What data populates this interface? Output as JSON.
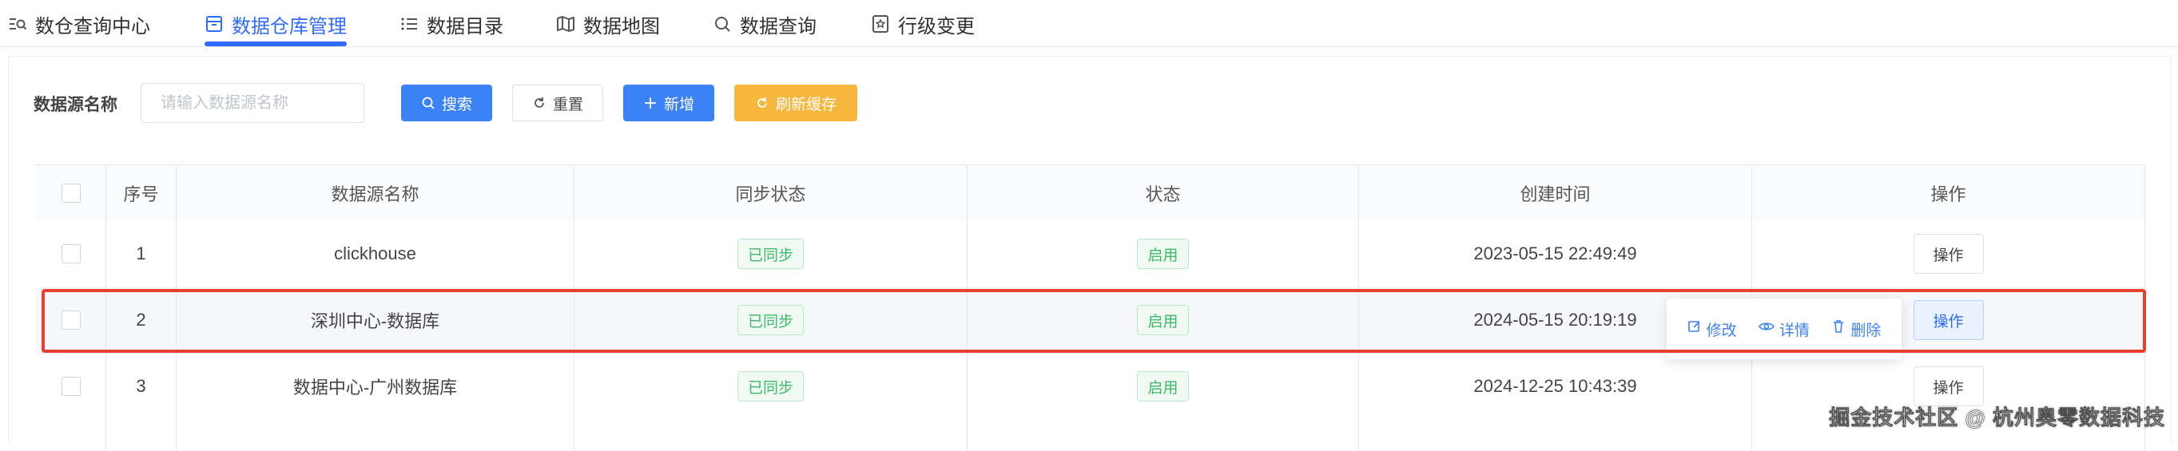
{
  "tabs": [
    {
      "label": "数仓查询中心",
      "icon": "query-list-icon"
    },
    {
      "label": "数据仓库管理",
      "icon": "warehouse-box-icon",
      "active": true
    },
    {
      "label": "数据目录",
      "icon": "catalog-list-icon"
    },
    {
      "label": "数据地图",
      "icon": "map-icon"
    },
    {
      "label": "数据查询",
      "icon": "search-icon"
    },
    {
      "label": "行级变更",
      "icon": "star-badge-icon"
    }
  ],
  "filter": {
    "label": "数据源名称",
    "placeholder": "请输入数据源名称",
    "search_label": "搜索",
    "reset_label": "重置",
    "add_label": "新增",
    "refresh_label": "刷新缓存"
  },
  "table": {
    "columns": [
      "序号",
      "数据源名称",
      "同步状态",
      "状态",
      "创建时间",
      "操作"
    ],
    "rows": [
      {
        "index": "1",
        "name": "clickhouse",
        "sync": "已同步",
        "status": "启用",
        "created": "2023-05-15 22:49:49",
        "action": "操作"
      },
      {
        "index": "2",
        "name": "深圳中心-数据库",
        "sync": "已同步",
        "status": "启用",
        "created": "2024-05-15 20:19:19",
        "action": "操作"
      },
      {
        "index": "3",
        "name": "数据中心-广州数据库",
        "sync": "已同步",
        "status": "启用",
        "created": "2024-12-25 10:43:39",
        "action": "操作"
      }
    ]
  },
  "row_actions": {
    "edit": "修改",
    "detail": "详情",
    "delete": "删除"
  },
  "watermark": "掘金技术社区 @ 杭州奥零数据科技",
  "colors": {
    "primary": "#3b82f6",
    "warning": "#f6b73c",
    "success": "#3cba6a",
    "highlight": "#e8402e"
  }
}
